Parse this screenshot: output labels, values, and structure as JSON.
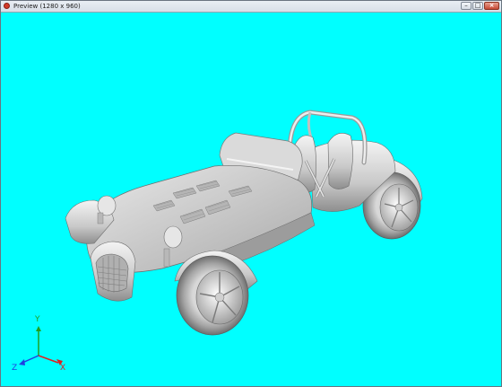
{
  "window": {
    "title": "Preview (1280 x 960)",
    "controls": {
      "minimize": "–",
      "maximize": "□",
      "close": "×"
    }
  },
  "viewport": {
    "background": "#00ffff",
    "model": "car-3d-model"
  },
  "axis_triad": {
    "x_label": "X",
    "y_label": "Y",
    "z_label": "Z",
    "colors": {
      "x": "#e02020",
      "y": "#20a020",
      "z": "#2040e0"
    }
  }
}
